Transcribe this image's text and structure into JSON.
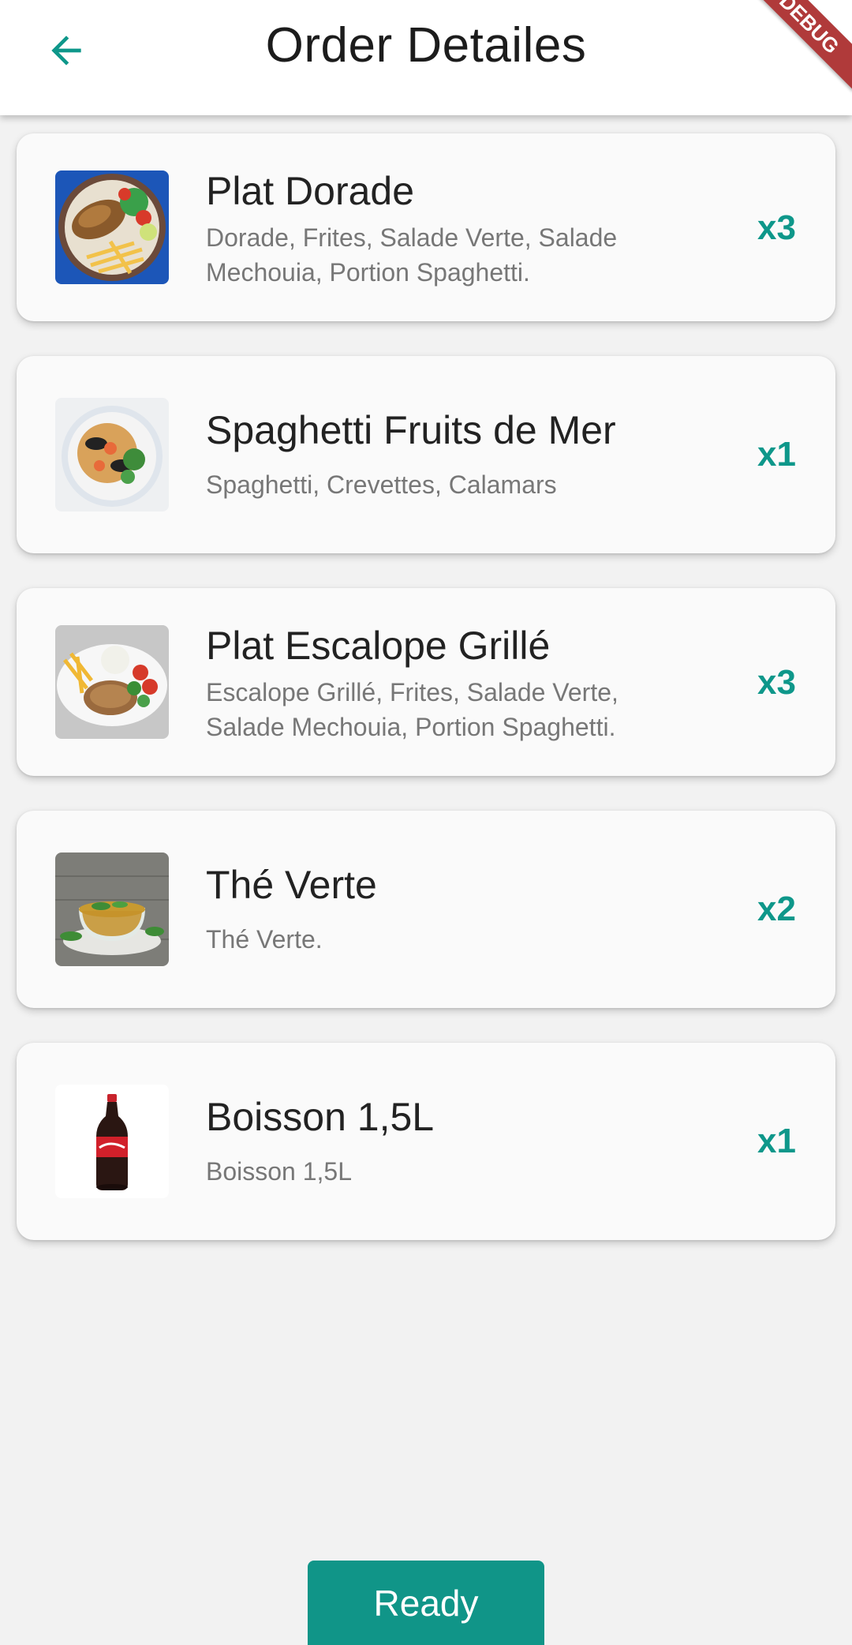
{
  "appbar": {
    "title": "Order Detailes",
    "back_icon": "arrow-left-icon",
    "accent": "#0e978a",
    "debug_banner": "DEBUG"
  },
  "items": [
    {
      "name": "Plat Dorade",
      "description": "Dorade, Frites, Salade Verte, Salade Mechouia, Portion Spaghetti.",
      "quantity": "x3",
      "image_icon": "grilled-fish-plate-icon"
    },
    {
      "name": "Spaghetti Fruits de Mer",
      "description": "Spaghetti, Crevettes, Calamars",
      "quantity": "x1",
      "image_icon": "seafood-pasta-icon"
    },
    {
      "name": "Plat Escalope Grillé",
      "description": "Escalope Grillé, Frites, Salade Verte, Salade Mechouia, Portion Spaghetti.",
      "quantity": "x3",
      "image_icon": "grilled-escalope-plate-icon"
    },
    {
      "name": "Thé Verte",
      "description": "Thé Verte.",
      "quantity": "x2",
      "image_icon": "green-tea-cup-icon"
    },
    {
      "name": "Boisson 1,5L",
      "description": "Boisson 1,5L",
      "quantity": "x1",
      "image_icon": "soda-bottle-icon"
    }
  ],
  "ready_button": {
    "label": "Ready",
    "color": "#109588"
  }
}
